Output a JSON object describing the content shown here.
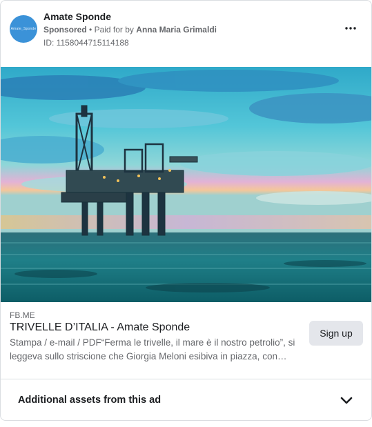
{
  "advertiser": {
    "name": "Amate Sponde",
    "avatar_text": "Amate_Sponde",
    "sponsored_label": "Sponsored",
    "separator": "•",
    "paid_for_prefix": "Paid for by",
    "payer_name": "Anna Maria Grimaldi",
    "ad_id": "ID: 1158044715114188"
  },
  "link": {
    "domain": "FB.ME",
    "headline": "TRIVELLE D’ITALIA - Amate Sponde",
    "description": "Stampa / e-mail / PDF“Ferma le trivelle, il mare è il nostro petrolio”, si leggeva sullo striscione che Giorgia Meloni esibiva in piazza, con…",
    "cta_label": "Sign up"
  },
  "footer": {
    "assets_label": "Additional assets from this ad"
  },
  "icons": {
    "more": "more-options-icon",
    "chevron": "chevron-down-icon"
  }
}
